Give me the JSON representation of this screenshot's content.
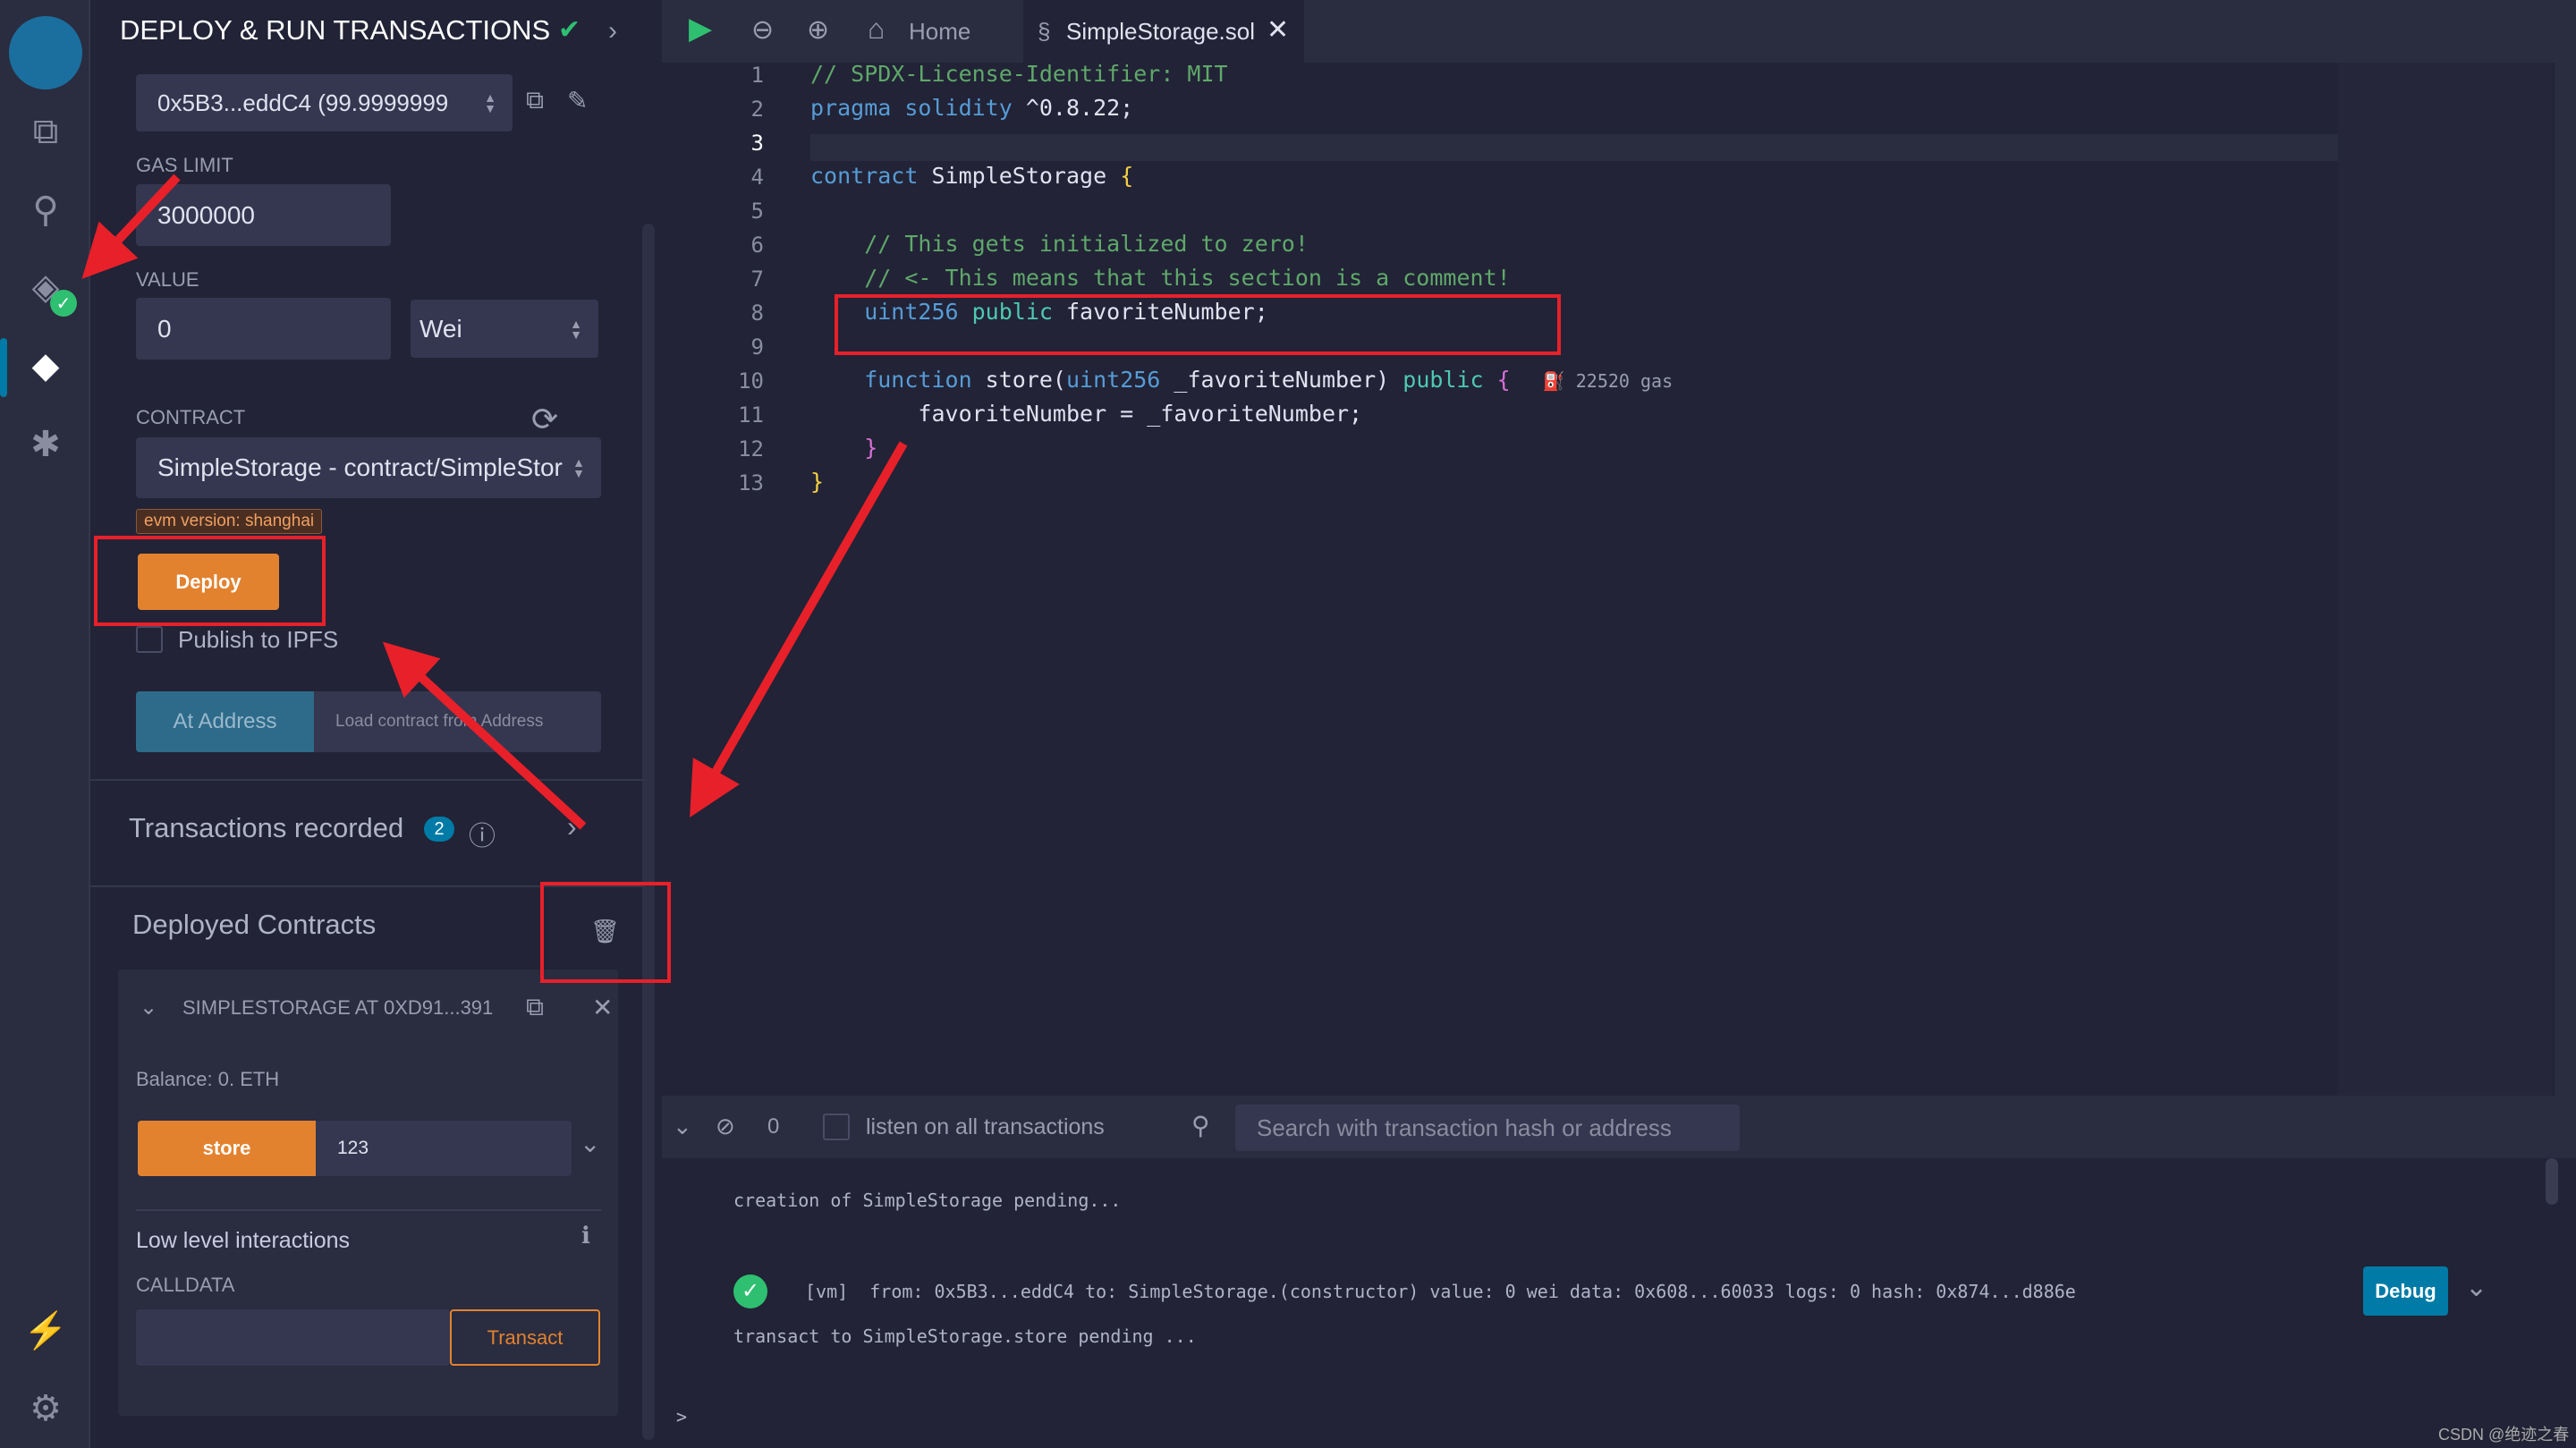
{
  "panel": {
    "title": "DEPLOY & RUN TRANSACTIONS",
    "account": "0x5B3...eddC4 (99.9999999",
    "gas_label": "GAS LIMIT",
    "gas_value": "3000000",
    "value_label": "VALUE",
    "value": "0",
    "unit": "Wei",
    "contract_label": "CONTRACT",
    "contract": "SimpleStorage - contract/SimpleStor",
    "evm_badge": "evm version: shanghai",
    "deploy": "Deploy",
    "publish": "Publish to IPFS",
    "at_address": "At Address",
    "load_placeholder": "Load contract from Address",
    "tx_recorded": "Transactions recorded",
    "tx_count": "2",
    "deployed": "Deployed Contracts",
    "instance": "SIMPLESTORAGE AT 0XD91...391",
    "balance": "Balance: 0. ETH",
    "store": "store",
    "store_value": "123",
    "low_level": "Low level interactions",
    "calldata": "CALLDATA",
    "transact": "Transact"
  },
  "tabs": {
    "home": "Home",
    "file": "SimpleStorage.sol"
  },
  "code": [
    [
      [
        "// SPDX-License-Identifier: MIT",
        "c"
      ]
    ],
    [
      [
        "pragma solidity ",
        "k"
      ],
      [
        "^0.8.22;",
        "w"
      ]
    ],
    [],
    [
      [
        "contract ",
        "k"
      ],
      [
        "SimpleStorage ",
        "w"
      ],
      [
        "{",
        "y"
      ]
    ],
    [],
    [
      [
        "    // This gets initialized to zero!",
        "c"
      ]
    ],
    [
      [
        "    // <- This means that this section is a comment!",
        "c"
      ]
    ],
    [
      [
        "    uint256 ",
        "k"
      ],
      [
        "public ",
        "t"
      ],
      [
        "favoriteNumber;",
        "w"
      ]
    ],
    [],
    [
      [
        "    function ",
        "k"
      ],
      [
        "store(",
        "w"
      ],
      [
        "uint256 ",
        "k"
      ],
      [
        "_favoriteNumber) ",
        "w"
      ],
      [
        "public ",
        "t"
      ],
      [
        "{",
        "m"
      ],
      [
        "   ⛽ 22520 gas",
        "g"
      ]
    ],
    [
      [
        "        favoriteNumber = _favoriteNumber;",
        "w"
      ]
    ],
    [
      [
        "    }",
        "m"
      ]
    ],
    [
      [
        "}",
        "y"
      ]
    ]
  ],
  "terminal": {
    "count": "0",
    "listen": "listen on all transactions",
    "search_placeholder": "Search with transaction hash or address",
    "line1": "creation of SimpleStorage pending...",
    "tx": "[vm]  from: 0x5B3...eddC4 to: SimpleStorage.(constructor) value: 0 wei data: 0x608...60033 logs: 0 hash: 0x874...d886e",
    "line3": "transact to SimpleStorage.store pending ...",
    "debug": "Debug",
    "prompt": ">"
  },
  "watermark": "CSDN @绝迹之春",
  "colors": {
    "accent": "#e2822f",
    "success": "#2fbf71",
    "debug": "#007aa6",
    "annotation": "#e8202a"
  }
}
